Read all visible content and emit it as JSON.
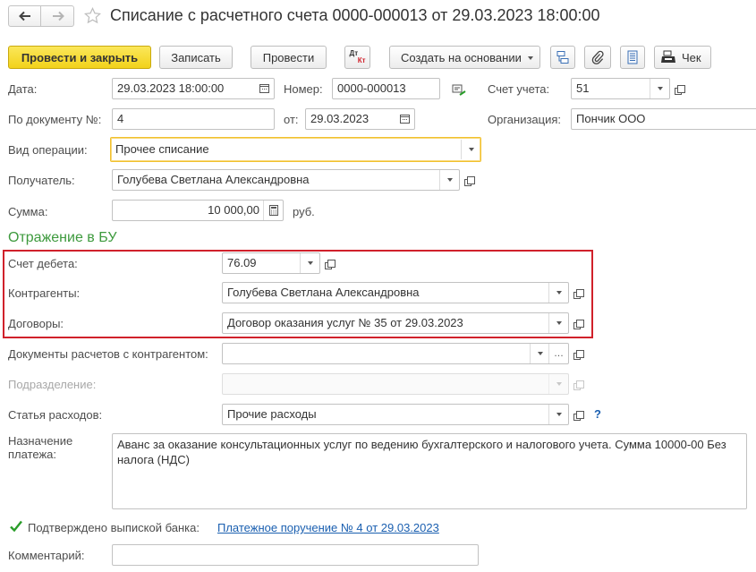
{
  "window": {
    "title": "Списание с расчетного счета 0000-000013 от 29.03.2023 18:00:00"
  },
  "toolbar": {
    "post_close_label": "Провести и закрыть",
    "save_label": "Записать",
    "post_label": "Провести",
    "dtkt_top": "Дт",
    "dtkt_bottom": "Кт",
    "create_based_label": "Создать на основании",
    "check_label": "Чек"
  },
  "form": {
    "date_label": "Дата:",
    "date_value": "29.03.2023 18:00:00",
    "number_label": "Номер:",
    "number_value": "0000-000013",
    "account_label": "Счет учета:",
    "account_value": "51",
    "doc_no_label": "По документу №:",
    "doc_no_value": "4",
    "from_label": "от:",
    "from_value": "29.03.2023",
    "org_label": "Организация:",
    "org_value": "Пончик ООО",
    "operation_label": "Вид операции:",
    "operation_value": "Прочее списание",
    "recipient_label": "Получатель:",
    "recipient_value": "Голубева Светлана Александровна",
    "sum_label": "Сумма:",
    "sum_value": "10 000,00",
    "currency": "руб."
  },
  "bu_section": {
    "title": "Отражение в БУ",
    "debit_label": "Счет дебета:",
    "debit_value": "76.09",
    "counterparty_label": "Контрагенты:",
    "counterparty_value": "Голубева Светлана Александровна",
    "contract_label": "Договоры:",
    "contract_value": "Договор оказания услуг № 35 от 29.03.2023",
    "settlement_docs_label": "Документы расчетов с контрагентом:",
    "settlement_docs_value": "",
    "dept_label": "Подразделение:",
    "dept_value": "",
    "expense_label": "Статья расходов:",
    "expense_value": "Прочие расходы",
    "help": "?"
  },
  "payment": {
    "purpose_label_line1": "Назначение",
    "purpose_label_line2": "платежа:",
    "purpose_value": "Аванс за оказание консультационных услуг по ведению бухгалтерского и налогового учета. Сумма 10000-00 Без налога (НДС)"
  },
  "confirm": {
    "label": "Подтверждено выпиской банка:",
    "checked": true,
    "link": "Платежное поручение № 4 от 29.03.2023"
  },
  "comment": {
    "label": "Комментарий:",
    "value": ""
  },
  "colors": {
    "accent_yellow": "#f2d21a",
    "section_green": "#3d9a3d",
    "highlight_red": "#d0212b",
    "link_blue": "#1a5fb0"
  }
}
